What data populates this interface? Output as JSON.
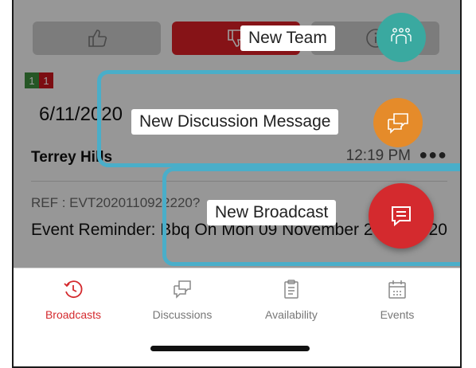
{
  "filter_tabs": {
    "likes_icon": "thumbs-up-icon",
    "dislikes_icon": "thumbs-down-icon",
    "info_icon": "info-icon"
  },
  "badges": {
    "green": "1",
    "red": "1"
  },
  "list": {
    "date_header": "6/11/2020",
    "item": {
      "name": "Terrey Hills",
      "time": "12:19 PM",
      "more": "●●●",
      "ref": "REF : EVT2020110922220?",
      "message": "Event Reminder: Bbq On Mon 09 November 2020 09:20"
    }
  },
  "fab_menu": {
    "new_team": "New Team",
    "new_discussion": "New Discussion Message",
    "new_broadcast": "New Broadcast"
  },
  "tabs": [
    {
      "label": "Broadcasts",
      "active": true
    },
    {
      "label": "Discussions",
      "active": false
    },
    {
      "label": "Availability",
      "active": false
    },
    {
      "label": "Events",
      "active": false
    }
  ],
  "colors": {
    "brand_red": "#d42a2e",
    "team_teal": "#3aa9a0",
    "discussion_orange": "#e58b2a",
    "highlight_blue": "#4aaec9"
  }
}
